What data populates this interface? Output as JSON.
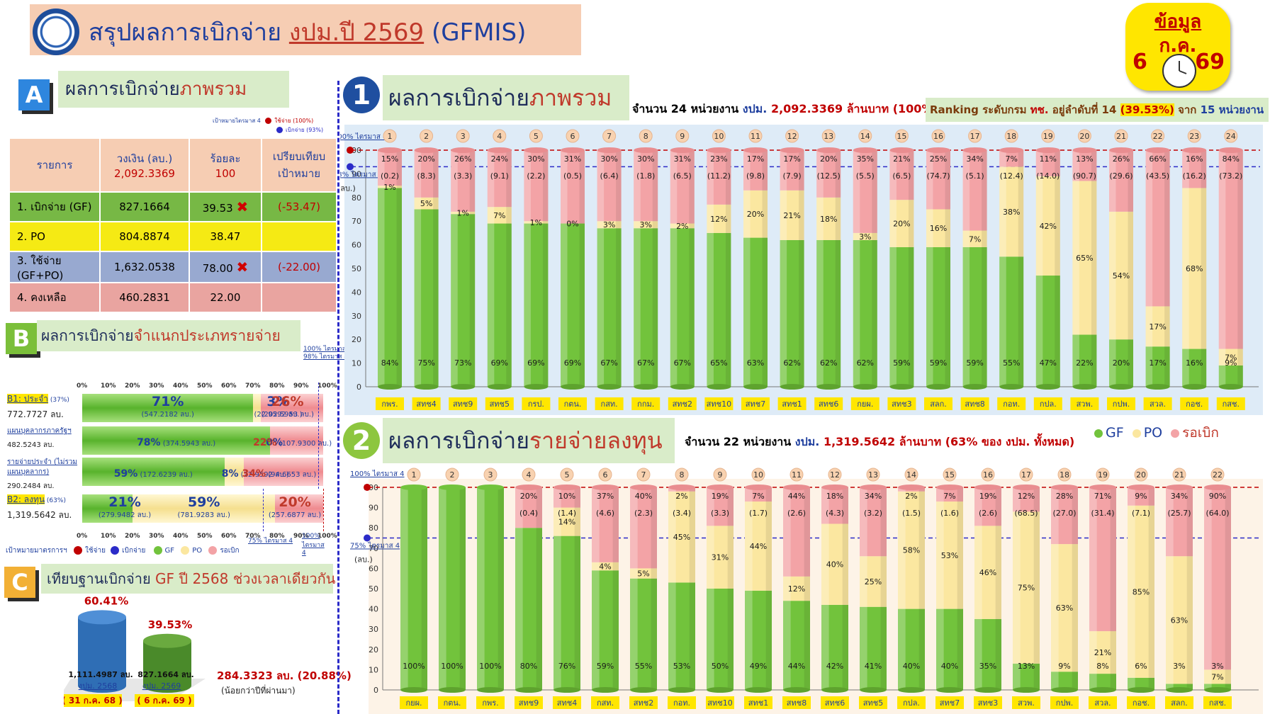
{
  "header": {
    "title_prefix": "สรุปผลการเบิกจ่าย",
    "title_budget": "งปม.ปี 2569",
    "title_suffix": "(GFMIS)",
    "badge_line1": "ข้อมูล",
    "badge_line2": "ก.ค.",
    "badge_day": "6",
    "badge_year": "69"
  },
  "section_a": {
    "letter": "A",
    "title_plain": "ผลการเบิกจ่าย",
    "title_highlight": "ภาพรวม",
    "legend_target_label": "เป้าหมายไตรมาส 4",
    "legend_spend": "ใช้จ่าย (100%)",
    "legend_disburse": "เบิกจ่าย (93%)",
    "table": {
      "headers": [
        "รายการ",
        "วงเงิน (ลบ.)",
        "ร้อยละ",
        "เปรียบเทียบ เป้าหมาย"
      ],
      "header_sub": [
        "",
        "2,092.3369",
        "100",
        ""
      ],
      "rows": [
        {
          "label": "1. เบิกจ่าย (GF)",
          "amount": "827.1664",
          "pct": "39.53",
          "mark": "✖",
          "compare": "(-53.47)"
        },
        {
          "label": "2. PO",
          "amount": "804.8874",
          "pct": "38.47",
          "mark": "",
          "compare": ""
        },
        {
          "label": "3. ใช้จ่าย (GF+PO)",
          "amount": "1,632.0538",
          "pct": "78.00",
          "mark": "✖",
          "compare": "(-22.00)"
        },
        {
          "label": "4. คงเหลือ",
          "amount": "460.2831",
          "pct": "22.00",
          "mark": "",
          "compare": ""
        }
      ]
    }
  },
  "section_b": {
    "letter": "B",
    "title_plain": "ผลการเบิกจ่าย",
    "title_highlight": "จำแนกประเภทรายจ่าย",
    "axis_ticks": [
      "0%",
      "10%",
      "20%",
      "30%",
      "40%",
      "50%",
      "60%",
      "70%",
      "80%",
      "90%",
      "100%"
    ],
    "target_top": "100% ไตรมาส 4",
    "target_top2": "98% ไตรมาส 4",
    "target_bottom": "75% ไตรมาส 4",
    "target_bottom2": "100% ไตรมาส 4",
    "rows": [
      {
        "label": "B1: ประจำ",
        "label_pct": "(37%)",
        "amount": "772.7727 ลบ.",
        "gf": "71%",
        "gf_amt": "(547.2182 ลบ.)",
        "po": "3%",
        "po_amt": "(22.9592 ลบ.)",
        "wait": "26%",
        "wait_amt": "(202.5953 ลบ.)",
        "gf_v": 71,
        "po_v": 3
      },
      {
        "label": "แผนบุคลากรภาครัฐฯ",
        "label_pct": "",
        "amount": "482.5243 ลบ.",
        "gf": "78%",
        "gf_amt": "(374.5943 ลบ.)",
        "po": "0%",
        "po_amt": "",
        "wait": "22%",
        "wait_amt": "(107.9300 ลบ.)",
        "gf_v": 78,
        "po_v": 0
      },
      {
        "label": "รายจ่ายประจำ (ไม่รวมแผนบุคลากร)",
        "label_pct": "",
        "amount": "290.2484 ลบ.",
        "gf": "59%",
        "gf_amt": "(172.6239 ลบ.)",
        "po": "8%",
        "po_amt": "(22.9592 ลบ.)",
        "wait": "34%",
        "wait_amt": "(94.6653 ลบ.)",
        "gf_v": 59,
        "po_v": 8
      },
      {
        "label": "B2: ลงทุน",
        "label_pct": "(63%)",
        "amount": "1,319.5642 ลบ.",
        "gf": "21%",
        "gf_amt": "(279.9482 ลบ.)",
        "po": "59%",
        "po_amt": "(781.9283 ลบ.)",
        "wait": "20%",
        "wait_amt": "(257.6877 ลบ.)",
        "gf_v": 21,
        "po_v": 59
      }
    ],
    "legend_target_text": "เป้าหมายมาตรการฯ",
    "legend_spend": "ใช้จ่าย",
    "legend_disburse": "เบิกจ่าย",
    "legend_gf": "GF",
    "legend_po": "PO",
    "legend_wait": "รอเบิก"
  },
  "section_c": {
    "letter": "C",
    "title_plain": "เทียบฐานเบิกจ่าย",
    "title_highlight": "GF ปี 2568 ช่วงเวลาเดียวกัน",
    "bar1_pct": "60.41%",
    "bar1_amt": "1,111.4987 ลบ.",
    "bar1_year": "งปม. 2568",
    "bar1_date": "( 31 ก.ค. 68 )",
    "bar1_value": 60.41,
    "bar2_pct": "39.53%",
    "bar2_amt": "827.1664 ลบ.",
    "bar2_year": "งปม. 2569",
    "bar2_date": "( 6 ก.ค. 69 )",
    "bar2_value": 39.53,
    "diff": "284.3323 ลบ. (20.88%)",
    "diff_note": "(น้อยกว่าปีที่ผ่านมา)"
  },
  "panel1": {
    "number": "1",
    "title_plain": "ผลการเบิกจ่าย",
    "title_highlight": "ภาพรวม",
    "info_a": "จำนวน 24 หน่วยงาน",
    "info_b": "งปม.",
    "info_c": "2,092.3369 ล้านบาท (100%)",
    "ranking_a": "Ranking ระดับกรม",
    "ranking_b": "ทช.",
    "ranking_c": "อยู่ลำดับที่ 14",
    "ranking_d": "(39.53%)",
    "ranking_e": "จาก",
    "ranking_f": "15 หน่วยงาน",
    "unit": "(ลบ.)",
    "target1": "100% ไตรมาส 4",
    "target2": "93% ไตรมาส 4"
  },
  "panel2": {
    "number": "2",
    "title_plain": "ผลการเบิกจ่าย",
    "title_highlight": "รายจ่ายลงทุน",
    "info_a": "จำนวน 22 หน่วยงาน",
    "info_b": "งปม.",
    "info_c": "1,319.5642 ล้านบาท",
    "info_d": "(63% ของ งปม. ทั้งหมด)",
    "unit": "(ลบ.)",
    "target1": "100% ไตรมาส 4",
    "target2": "75% ไตรมาส 4",
    "legend": [
      "GF",
      "PO",
      "รอเบิก"
    ]
  },
  "chart_data": [
    {
      "type": "bar",
      "stacked": true,
      "title": "ผลการเบิกจ่ายภาพรวม",
      "ylim": [
        0,
        100
      ],
      "yticks": [
        0,
        10,
        20,
        30,
        40,
        50,
        60,
        70,
        80,
        90,
        100
      ],
      "categories": [
        "กพร.",
        "สทช4",
        "สทช9",
        "สทช5",
        "กรป.",
        "กตน.",
        "กสท.",
        "กกม.",
        "สทช2",
        "สทช10",
        "สทช7",
        "สทช1",
        "สทช6",
        "กยผ.",
        "สทช3",
        "สลก.",
        "สทช8",
        "กอท.",
        "กปล.",
        "สวพ.",
        "กปพ.",
        "สวล.",
        "กอช.",
        "กสช."
      ],
      "ranks": [
        "1",
        "2",
        "3",
        "4",
        "5",
        "6",
        "7",
        "8",
        "9",
        "10",
        "11",
        "12",
        "13",
        "14",
        "15",
        "16",
        "17",
        "18",
        "19",
        "20",
        "21",
        "22",
        "23",
        "24"
      ],
      "series": [
        {
          "name": "GF",
          "values": [
            84,
            75,
            73,
            69,
            69,
            69,
            67,
            67,
            67,
            65,
            63,
            62,
            62,
            62,
            59,
            59,
            59,
            55,
            47,
            22,
            20,
            17,
            16,
            9
          ]
        },
        {
          "name": "PO",
          "values": [
            1,
            5,
            1,
            7,
            1,
            0,
            3,
            3,
            2,
            12,
            20,
            21,
            18,
            3,
            20,
            16,
            7,
            38,
            42,
            65,
            54,
            17,
            68,
            7
          ]
        },
        {
          "name": "รอเบิก",
          "values": [
            15,
            20,
            26,
            24,
            30,
            31,
            30,
            30,
            31,
            23,
            17,
            17,
            20,
            35,
            21,
            25,
            34,
            7,
            11,
            13,
            26,
            66,
            16,
            84
          ]
        }
      ],
      "remaining": [
        "(0.2)",
        "(8.3)",
        "(3.3)",
        "(9.1)",
        "(2.2)",
        "(0.5)",
        "(6.4)",
        "(1.8)",
        "(6.5)",
        "(11.2)",
        "(9.8)",
        "(7.9)",
        "(12.5)",
        "(5.5)",
        "(6.5)",
        "(74.7)",
        "(5.1)",
        "(12.4)",
        "(14.0)",
        "(90.7)",
        "(29.6)",
        "(43.5)",
        "(16.2)",
        "(73.2)"
      ],
      "target_lines": [
        100,
        93
      ]
    },
    {
      "type": "bar",
      "stacked": true,
      "title": "ผลการเบิกจ่ายรายจ่ายลงทุน",
      "ylim": [
        0,
        100
      ],
      "yticks": [
        0,
        10,
        20,
        30,
        40,
        50,
        60,
        70,
        80,
        90,
        100
      ],
      "categories": [
        "กยผ.",
        "กตน.",
        "กพร.",
        "สทช9",
        "สทช4",
        "กสท.",
        "สทช2",
        "กอท.",
        "สทช10",
        "สทช1",
        "สทช8",
        "สทช6",
        "สทช5",
        "กปล.",
        "สทช7",
        "สทช3",
        "สวพ.",
        "กปพ.",
        "สวล.",
        "กอช.",
        "สลก.",
        "กสช."
      ],
      "ranks": [
        "1",
        "2",
        "3",
        "4",
        "5",
        "6",
        "7",
        "8",
        "9",
        "10",
        "11",
        "12",
        "13",
        "14",
        "15",
        "16",
        "17",
        "18",
        "19",
        "20",
        "21",
        "22"
      ],
      "series": [
        {
          "name": "GF",
          "values": [
            100,
            100,
            100,
            80,
            76,
            59,
            55,
            53,
            50,
            49,
            44,
            42,
            41,
            40,
            40,
            35,
            13,
            9,
            8,
            6,
            3,
            3
          ]
        },
        {
          "name": "PO",
          "values": [
            0,
            0,
            0,
            0,
            14,
            4,
            5,
            45,
            31,
            44,
            12,
            40,
            25,
            58,
            53,
            46,
            75,
            63,
            21,
            85,
            63,
            7
          ]
        },
        {
          "name": "รอเบิก",
          "values": [
            0,
            0,
            0,
            20,
            10,
            37,
            40,
            2,
            19,
            7,
            44,
            18,
            34,
            2,
            7,
            19,
            12,
            28,
            71,
            9,
            34,
            90
          ]
        }
      ],
      "remaining": [
        "",
        "",
        "",
        "(0.4)",
        "(1.4)",
        "(4.6)",
        "(2.3)",
        "(3.4)",
        "(3.3)",
        "(1.7)",
        "(2.6)",
        "(4.3)",
        "(3.2)",
        "(1.5)",
        "(1.6)",
        "(2.6)",
        "(68.5)",
        "(27.0)",
        "(31.4)",
        "(7.1)",
        "(25.7)",
        "(64.0)"
      ],
      "target_lines": [
        100,
        75
      ]
    }
  ],
  "colors": {
    "gf": "#72c33c",
    "po": "#fbe7a0",
    "wait": "#f3a3a6",
    "title_blue": "#1f3f9e",
    "accent_red": "#c0392b"
  }
}
